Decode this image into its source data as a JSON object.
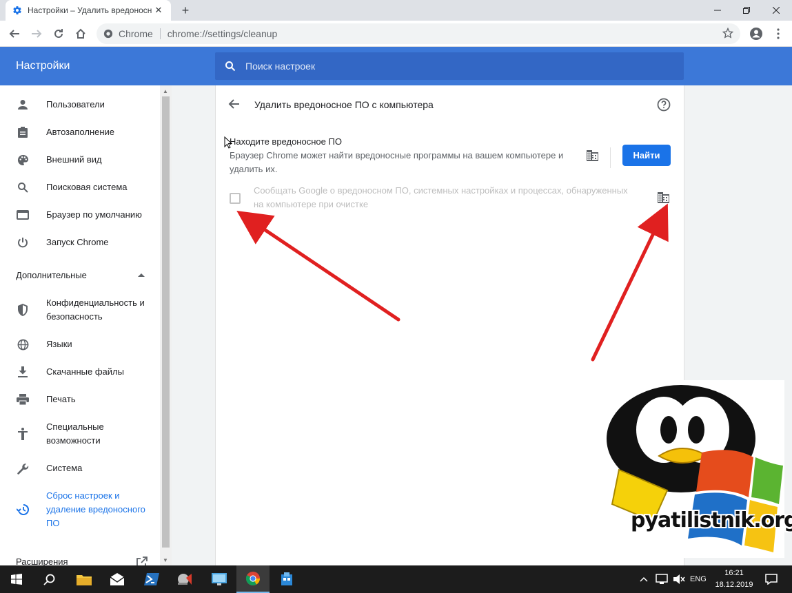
{
  "browser": {
    "tab_title": "Настройки – Удалить вредоносное ПО с компьютера",
    "tab_title_visible": "Настройки – Удалить вредоносн",
    "close_tab": "✕",
    "new_tab": "+",
    "omnibox_chip": "Chrome",
    "url": "chrome://settings/cleanup"
  },
  "header": {
    "title": "Настройки",
    "search_placeholder": "Поиск настроек"
  },
  "sidebar": {
    "items": [
      {
        "label": "Пользователи",
        "icon": "person-icon"
      },
      {
        "label": "Автозаполнение",
        "icon": "clipboard-icon"
      },
      {
        "label": "Внешний вид",
        "icon": "palette-icon"
      },
      {
        "label": "Поисковая система",
        "icon": "search-icon"
      },
      {
        "label": "Браузер по умолчанию",
        "icon": "browser-icon"
      },
      {
        "label": "Запуск Chrome",
        "icon": "power-icon"
      }
    ],
    "advanced_label": "Дополнительные",
    "advanced_items": [
      {
        "label": "Конфиденциальность и безопасность",
        "icon": "shield-icon"
      },
      {
        "label": "Языки",
        "icon": "globe-icon"
      },
      {
        "label": "Скачанные файлы",
        "icon": "download-icon"
      },
      {
        "label": "Печать",
        "icon": "printer-icon"
      },
      {
        "label": "Специальные возможности",
        "icon": "accessibility-icon"
      },
      {
        "label": "Система",
        "icon": "wrench-icon"
      },
      {
        "label": "Сброс настроек и удаление вредоносного ПО",
        "icon": "restore-icon"
      }
    ],
    "extensions_label": "Расширения"
  },
  "main": {
    "page_title": "Удалить вредоносное ПО с компьютера",
    "section_title": "Находите вредоносное ПО",
    "section_desc": "Браузер Chrome может найти вредоносные программы на вашем компьютере и удалить их.",
    "find_button": "Найти",
    "report_text": "Сообщать Google о вредоносном ПО, системных настройках и процессах, обнаруженных на компьютере при очистке",
    "report_checked": false
  },
  "watermark": {
    "text": "pyatilistnik.org"
  },
  "taskbar": {
    "language": "ENG",
    "time": "16:21",
    "date": "18.12.2019"
  },
  "colors": {
    "header": "#3c78d8",
    "accent": "#1a73e8",
    "arrow": "#e02020"
  }
}
